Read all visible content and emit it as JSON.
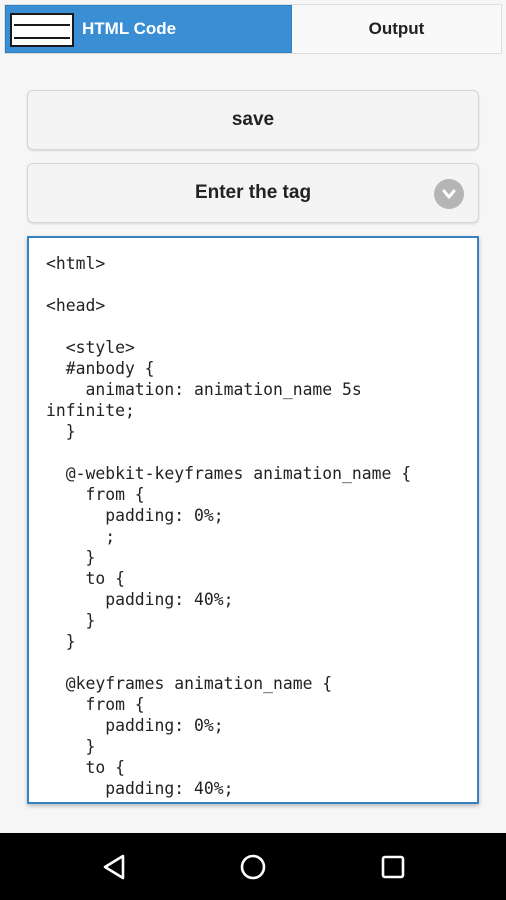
{
  "tabs": {
    "html_code": "HTML Code",
    "output": "Output"
  },
  "buttons": {
    "save": "save",
    "tag_select": "Enter the tag"
  },
  "editor": {
    "code": "<html>\n\n<head>\n\n  <style>\n  #anbody {\n    animation: animation_name 5s\ninfinite;\n  }\n\n  @-webkit-keyframes animation_name {\n    from {\n      padding: 0%;\n      ;\n    }\n    to {\n      padding: 40%;\n    }\n  }\n\n  @keyframes animation_name {\n    from {\n      padding: 0%;\n    }\n    to {\n      padding: 40%;"
  },
  "colors": {
    "accent": "#3a8fd4",
    "editor_border": "#3a7fc0",
    "navbar": "#000000"
  },
  "icons": {
    "tab_icon": "code-editor-icon",
    "dropdown": "chevron-down-circle-icon",
    "nav_back": "back-triangle-icon",
    "nav_home": "home-circle-icon",
    "nav_recents": "recents-square-icon"
  }
}
